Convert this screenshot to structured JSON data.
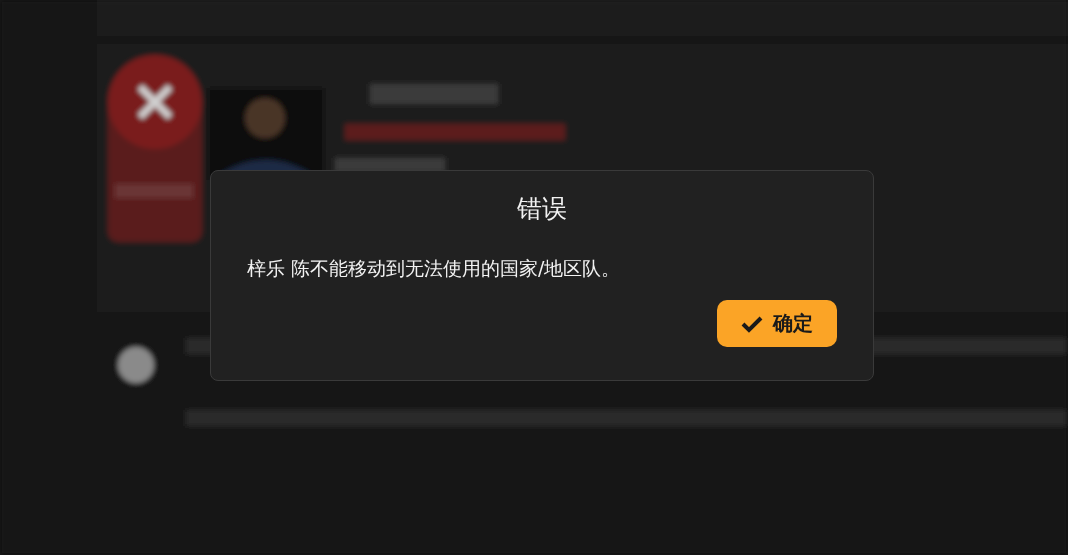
{
  "dialog": {
    "title": "错误",
    "message": "梓乐 陈不能移动到无法使用的国家/地区队。",
    "buttons": [
      {
        "label": "确定",
        "kind": "confirm"
      }
    ]
  }
}
